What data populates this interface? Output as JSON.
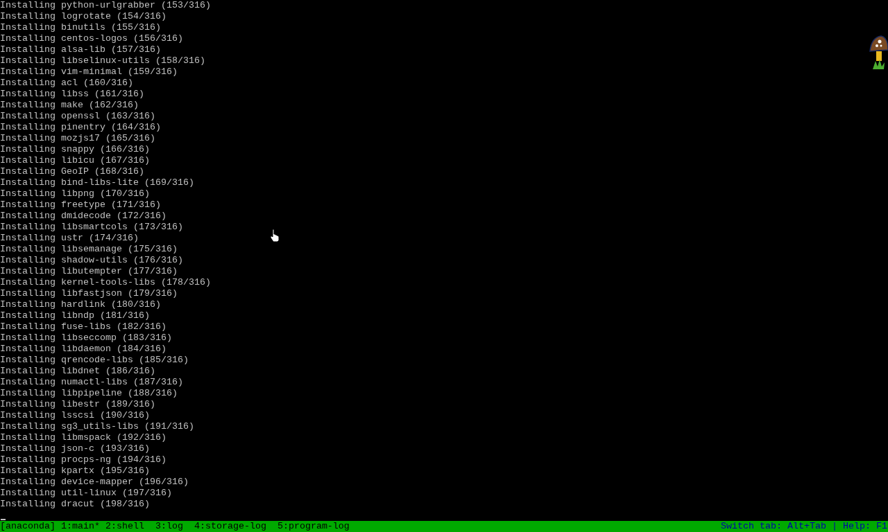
{
  "terminal": {
    "lines": [
      "Installing python-urlgrabber (153/316)",
      "Installing logrotate (154/316)",
      "Installing binutils (155/316)",
      "Installing centos-logos (156/316)",
      "Installing alsa-lib (157/316)",
      "Installing libselinux-utils (158/316)",
      "Installing vim-minimal (159/316)",
      "Installing acl (160/316)",
      "Installing libss (161/316)",
      "Installing make (162/316)",
      "Installing openssl (163/316)",
      "Installing pinentry (164/316)",
      "Installing mozjs17 (165/316)",
      "Installing snappy (166/316)",
      "Installing libicu (167/316)",
      "Installing GeoIP (168/316)",
      "Installing bind-libs-lite (169/316)",
      "Installing libpng (170/316)",
      "Installing freetype (171/316)",
      "Installing dmidecode (172/316)",
      "Installing libsmartcols (173/316)",
      "Installing ustr (174/316)",
      "Installing libsemanage (175/316)",
      "Installing shadow-utils (176/316)",
      "Installing libutempter (177/316)",
      "Installing kernel-tools-libs (178/316)",
      "Installing libfastjson (179/316)",
      "Installing hardlink (180/316)",
      "Installing libndp (181/316)",
      "Installing fuse-libs (182/316)",
      "Installing libseccomp (183/316)",
      "Installing libdaemon (184/316)",
      "Installing qrencode-libs (185/316)",
      "Installing libdnet (186/316)",
      "Installing numactl-libs (187/316)",
      "Installing libpipeline (188/316)",
      "Installing libestr (189/316)",
      "Installing lsscsi (190/316)",
      "Installing sg3_utils-libs (191/316)",
      "Installing libmspack (192/316)",
      "Installing json-c (193/316)",
      "Installing procps-ng (194/316)",
      "Installing kpartx (195/316)",
      "Installing device-mapper (196/316)",
      "Installing util-linux (197/316)",
      "Installing dracut (198/316)"
    ]
  },
  "status_bar": {
    "session": "[anaconda]",
    "tabs": [
      "1:main*",
      "2:shell",
      "3:log",
      "4:storage-log",
      "5:program-log"
    ],
    "help": "Switch tab: Alt+Tab | Help: F1"
  }
}
